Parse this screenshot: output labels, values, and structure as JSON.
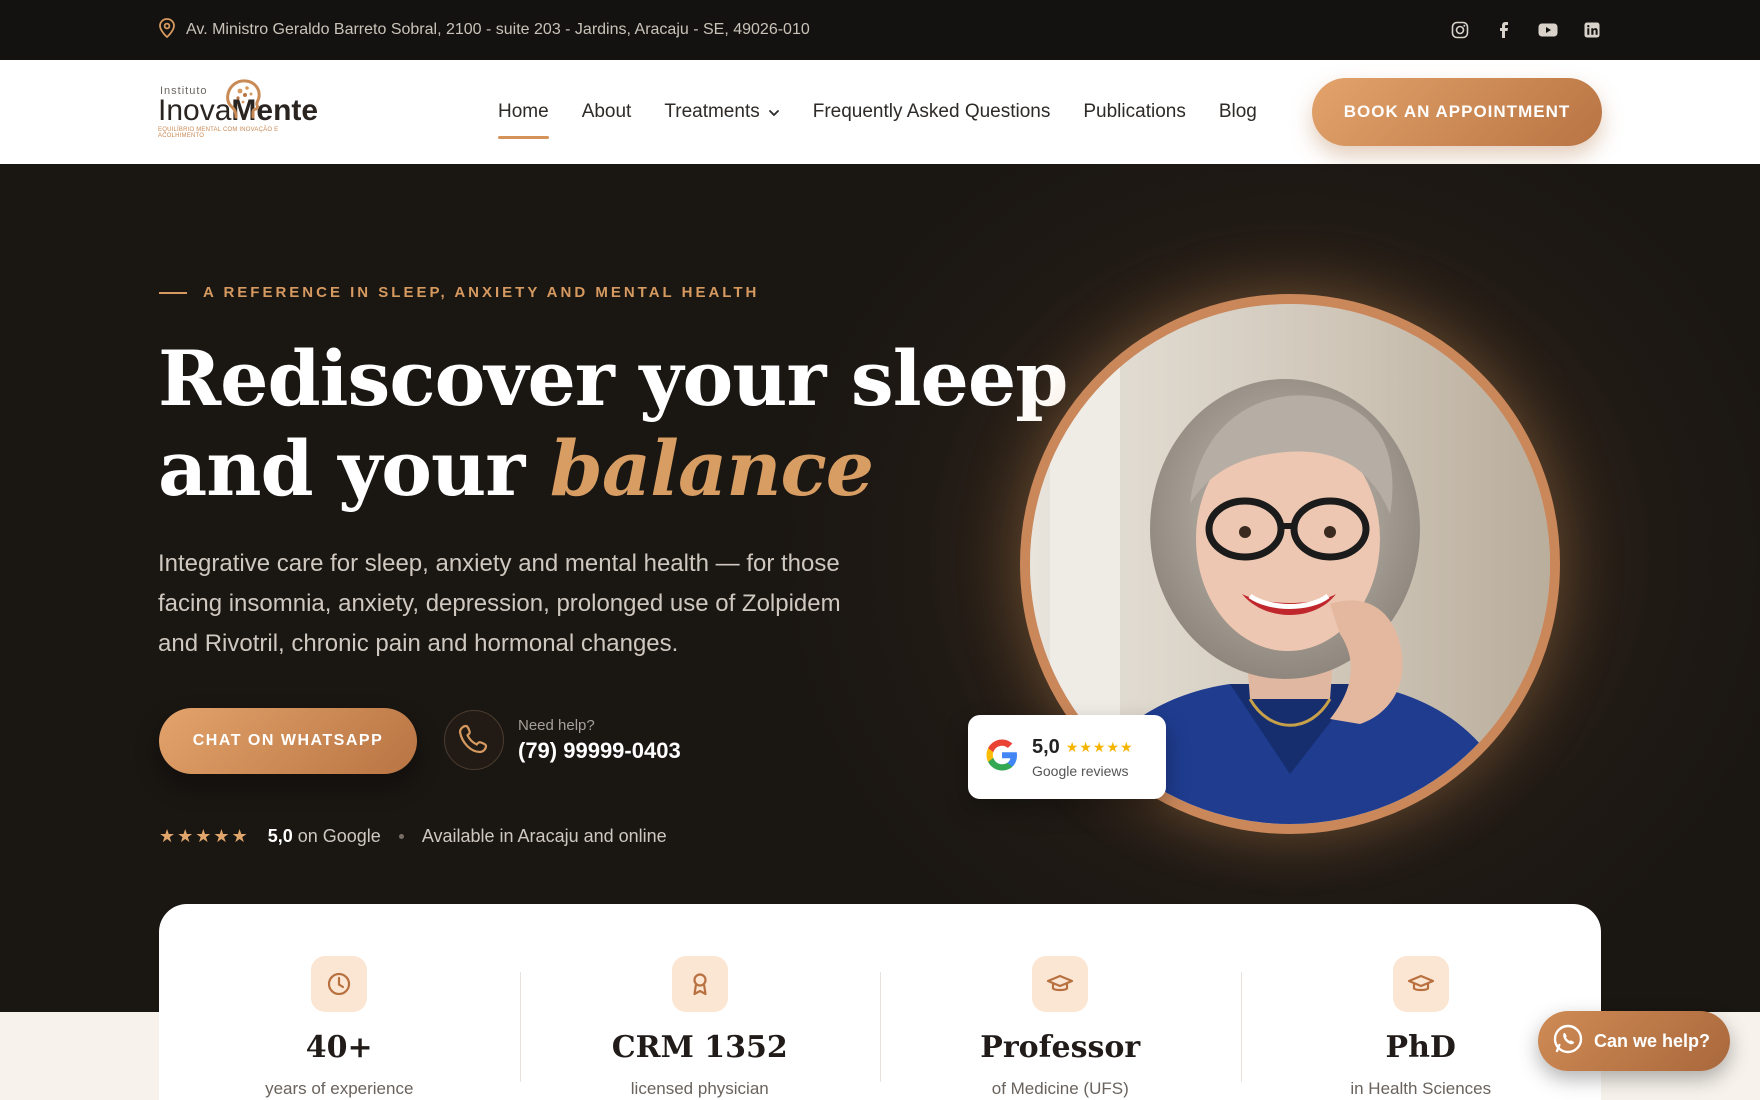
{
  "topbar": {
    "address": "Av. Ministro Geraldo Barreto Sobral, 2100 - suite 203 - Jardins, Aracaju - SE, 49026-010",
    "socials": [
      "instagram-icon",
      "facebook-icon",
      "youtube-icon",
      "linkedin-icon"
    ]
  },
  "logo": {
    "small": "Instituto",
    "main_light": "Inova",
    "main_bold": "Mente",
    "tagline": "EQUILÍBRIO MENTAL COM INOVAÇÃO E ACOLHIMENTO"
  },
  "nav": {
    "items": [
      {
        "label": "Home"
      },
      {
        "label": "About"
      },
      {
        "label": "Treatments"
      },
      {
        "label": "Frequently Asked Questions"
      },
      {
        "label": "Publications"
      },
      {
        "label": "Blog"
      }
    ],
    "active": "Home",
    "cta": "BOOK AN APPOINTMENT"
  },
  "hero": {
    "eyebrow": "A REFERENCE IN SLEEP, ANXIETY AND MENTAL HEALTH",
    "title_line1": "Rediscover your sleep",
    "title_line2_start": "and your ",
    "title_accent": "balance",
    "lead": "Integrative care for sleep, anxiety and mental health — for those facing insomnia, anxiety, depression, prolonged use of Zolpidem and Rivotril, chronic pain and hormonal changes.",
    "whatsapp_button": "CHAT ON WHATSAPP",
    "phone_label": "Need help?",
    "phone_number": "(79) 99999-0403",
    "rating_stars": "★★★★★",
    "rating_score": "5,0",
    "rating_suffix": "on Google",
    "availability": "Available in Aracaju and online"
  },
  "google_badge": {
    "score": "5,0",
    "stars": "★★★★★",
    "label": "Google reviews"
  },
  "stats": [
    {
      "icon": "clock-icon",
      "value": "40+",
      "label": "years of experience"
    },
    {
      "icon": "ribbon-icon",
      "value": "CRM 1352",
      "label": "licensed physician"
    },
    {
      "icon": "graduation-cap-icon",
      "value": "Professor",
      "label": "of Medicine (UFS)"
    },
    {
      "icon": "graduation-cap-icon",
      "value": "PhD",
      "label": "in Health Sciences"
    }
  ],
  "help_button": "Can we help?",
  "colors": {
    "accent": "#d69a60",
    "dark_bg": "#1b1713",
    "topbar_bg": "#141210"
  }
}
